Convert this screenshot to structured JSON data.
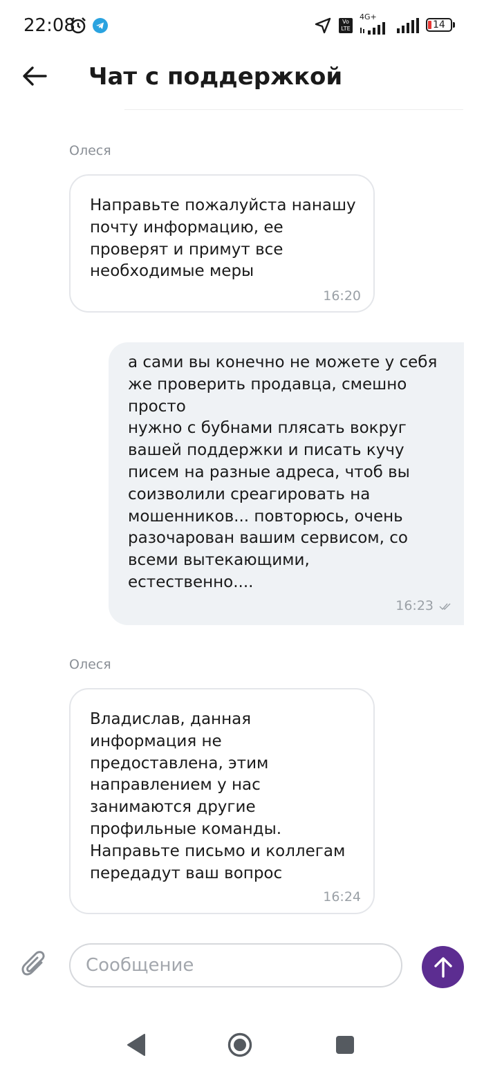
{
  "status_bar": {
    "time": "22:08",
    "network_label": "4G+",
    "volte_label": "Vo LTE",
    "battery_level": "14",
    "icons": [
      "alarm-icon",
      "telegram-icon",
      "location-icon",
      "volte-icon",
      "signal-icon",
      "signal-icon",
      "battery-icon"
    ]
  },
  "header": {
    "title": "Чат с поддержкой",
    "back_icon": "arrow-left-icon"
  },
  "messages": [
    {
      "direction": "incoming",
      "sender": "Олеся",
      "text": "Направьте пожалуйста нанашу\nпочту информацию, ее\nпроверят и примут все\nнеобходимые меры",
      "time": "16:20"
    },
    {
      "direction": "outgoing",
      "text": "а сами вы конечно не можете у себя\nже проверить продавца, смешно\nпросто\nнужно с бубнами плясать вокруг\nвашей поддержки и писать кучу\nписем на разные адреса, чтоб вы\nсоизволили среагировать на\nмошенников... повторюсь, очень\nразочарован вашим сервисом, со\nвсеми вытекающими,\nестественно....",
      "time": "16:23",
      "status": "read"
    },
    {
      "direction": "incoming",
      "sender": "Олеся",
      "text": "Владислав, данная\nинформация не\nпредоставлена, этим\nнаправлением у нас\nзанимаются другие\nпрофильные команды.\nНаправьте письмо и коллегам\nпередадут ваш вопрос",
      "time": "16:24"
    }
  ],
  "composer": {
    "placeholder": "Сообщение",
    "value": "",
    "attach_icon": "paperclip-icon",
    "send_icon": "arrow-up-icon"
  },
  "colors": {
    "accent": "#5c2d91",
    "outgoing_bubble": "#eff2f5",
    "incoming_border": "#e4e6ea",
    "muted_text": "#8a8f96"
  },
  "nav_bar": {
    "icons": [
      "nav-back-icon",
      "nav-home-icon",
      "nav-recents-icon"
    ]
  }
}
